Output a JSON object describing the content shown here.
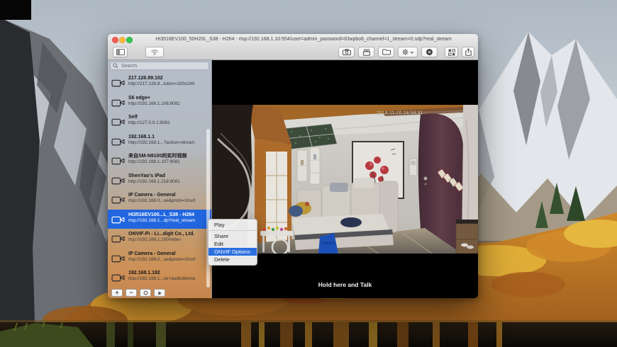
{
  "window": {
    "title": "HI3516EV100_50H20L_S38 - H264 - rtsp://192.168.1.10:554/user=admin_password=tlJwpbo6_channel=1_stream=0.sdp?real_stream"
  },
  "toolbar": {
    "left_icons": [
      "sidebar-toggle",
      "wifi-stream"
    ],
    "right_icons": [
      "snapshot-camera",
      "record-camera",
      "open-folder",
      "settings-gear",
      "stop-record",
      "mosaic-grid",
      "share"
    ]
  },
  "sidebar": {
    "search_placeholder": "Search",
    "cameras": [
      {
        "name": "217.126.89.102",
        "url": "http://217.126.8...lution=320x240"
      },
      {
        "name": "S6 edge+",
        "url": "http://192.168.1.108:8081"
      },
      {
        "name": "Self",
        "url": "http://127.0.0.1:8081"
      },
      {
        "name": "192.168.1.1",
        "url": "http://192.168.1...?action=stream"
      },
      {
        "name": "来自SM-N9100的实时视频",
        "url": "http://192.168.1.107:8081"
      },
      {
        "name": "ShenYao's iPad",
        "url": "http://192.168.1.218:8081"
      },
      {
        "name": "IP Camera - General",
        "url": "rtsp://192.168.0...ue&proto=Onvif"
      },
      {
        "name": "HI3516EV100...L_S38 - H264",
        "url": "rtsp://192.168.1...dp?real_stream",
        "selected": true
      },
      {
        "name": "ONVIF-Pi - Li...digit Co., Ltd.",
        "url": "rtsp://192.168.1.150/video"
      },
      {
        "name": "IP Camera - General",
        "url": "rtsp://192.168.0...ue&proto=Onvif"
      },
      {
        "name": "192.168.1.182",
        "url": "rtsp://192.168.1...ce+audiodevice"
      }
    ],
    "footer": {
      "add_label": "+",
      "remove_label": "−"
    }
  },
  "video": {
    "timestamp": "2018-11-20 16:58:31",
    "talk_button_label": "Hold here and Talk"
  },
  "context_menu": {
    "items": [
      "Play",
      "Share",
      "Edit",
      "ONVIF Options",
      "Delete"
    ],
    "highlighted": "ONVIF Options"
  },
  "colors": {
    "accent_blue": "#2166df",
    "menu_highlight_blue": "#2a6fdf",
    "traffic_red": "#f55f57",
    "traffic_yellow": "#fdbc40",
    "traffic_green": "#34c84a",
    "osd_text": "#e9e5bd"
  }
}
